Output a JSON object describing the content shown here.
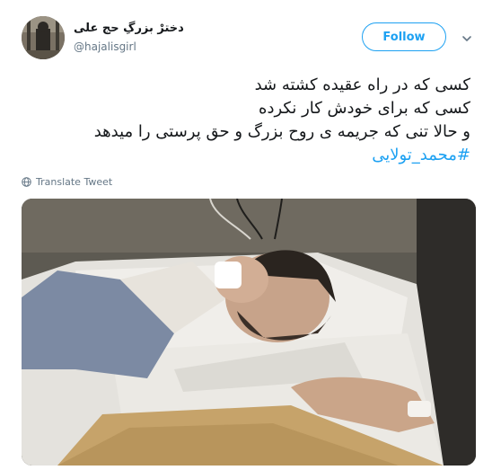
{
  "user": {
    "display_name": "دخترْ بزرگِ حج علی",
    "handle": "@hajalisgirl"
  },
  "actions": {
    "follow_label": "Follow"
  },
  "tweet": {
    "lines": [
      "کسی که در راه عقیده کشته شد",
      "کسی که برای خودش کار نکرده",
      "و حالا تنی که جریمه ی روح بزرگ و حق پرستی را میدهد"
    ],
    "hashtag": "#محمد_تولایی"
  },
  "translate_label": "Translate Tweet",
  "icons": {
    "chevron": "chevron-down-icon",
    "globe": "globe-icon"
  },
  "colors": {
    "accent": "#1da1f2",
    "text": "#14171a",
    "muted": "#657786"
  }
}
